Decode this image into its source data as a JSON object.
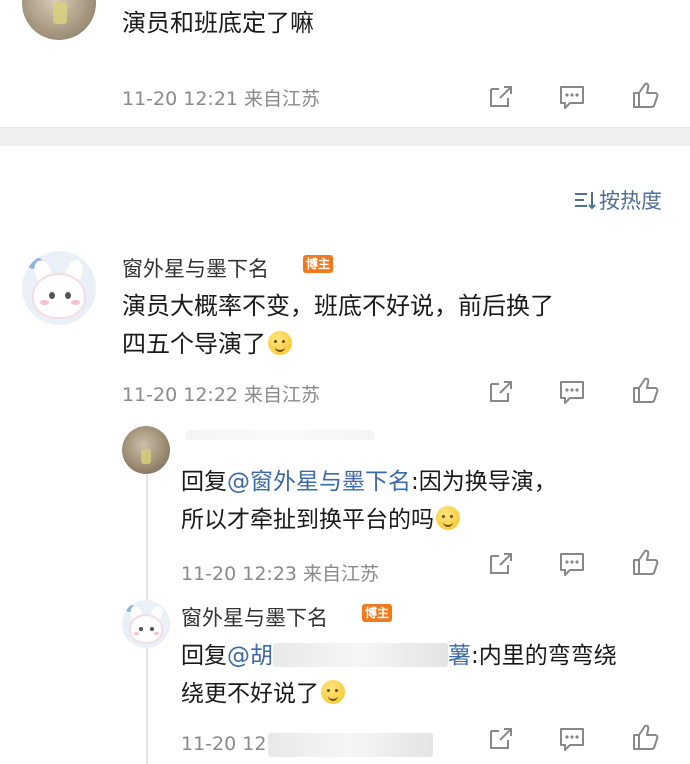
{
  "comments": [
    {
      "text": "演员和班底定了嘛",
      "meta": "11-20 12:21  来自江苏"
    },
    {
      "name": "窗外星与墨下名",
      "badge": "博主",
      "text_line1": "演员大概率不变，班底不好说，前后换了",
      "text_line2": "四五个导演了",
      "meta": "11-20 12:22  来自江苏"
    }
  ],
  "sort": {
    "label": "按热度",
    "icon": "sort-icon"
  },
  "replies": [
    {
      "reply_prefix": "回复",
      "mention": "@窗外星与墨下名",
      "text_line1_rest": ":因为换导演，",
      "text_line2": "所以才牵扯到换平台的吗",
      "meta": "11-20 12:23  来自江苏"
    },
    {
      "name": "窗外星与墨下名",
      "badge": "博主",
      "reply_prefix": "回复",
      "mention_visible_start": "@胡",
      "mention_visible_end": "薯",
      "text_line1_rest": ":内里的弯弯绕",
      "text_line2": "绕更不好说了",
      "meta_visible": "11-20 12"
    }
  ],
  "icons": [
    "share-icon",
    "comment-icon",
    "like-icon",
    "laugh-cry-emoji",
    "sob-emoji"
  ]
}
